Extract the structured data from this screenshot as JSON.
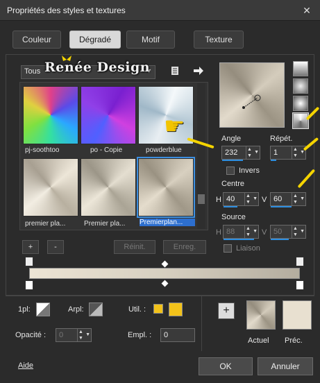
{
  "window": {
    "title": "Propriétés des styles et textures",
    "close_glyph": "✕"
  },
  "tabs": [
    "Couleur",
    "Dégradé",
    "Motif",
    "Texture"
  ],
  "active_tab": "Dégradé",
  "library": {
    "category": "Tous",
    "watermark": "Renée Design",
    "items": [
      {
        "label": "pj-soothtoo",
        "selected": false
      },
      {
        "label": "po - Copie",
        "selected": false
      },
      {
        "label": "powderblue",
        "selected": false
      },
      {
        "label": "premier pla...",
        "selected": false
      },
      {
        "label": "Premier pla...",
        "selected": false
      },
      {
        "label": "Premierplan...",
        "selected": true
      }
    ],
    "add_label": "+",
    "remove_label": "-",
    "reset_label": "Réinit.",
    "save_label": "Enreg."
  },
  "settings": {
    "angle_label": "Angle",
    "angle_value": "232",
    "repeat_label": "Répét.",
    "repeat_value": "1",
    "invert_label": "Invers",
    "center_label": "Centre",
    "center_h_label": "H",
    "center_h": "40",
    "center_v_label": "V",
    "center_v": "60",
    "source_label": "Source",
    "source_h_label": "H",
    "source_h": "88",
    "source_v_label": "V",
    "source_v": "50",
    "link_label": "Liaison"
  },
  "bottom": {
    "pl_label": "1pl:",
    "arpl_label": "Arpl:",
    "util_label": "Util. :",
    "opacity_label": "Opacité :",
    "opacity_value": "0",
    "empl_label": "Empl. :",
    "empl_value": "0",
    "current_label": "Actuel",
    "prev_label": "Préc.",
    "add_glyph": "+"
  },
  "footer": {
    "help_label": "Aide",
    "ok_label": "OK",
    "cancel_label": "Annuler"
  },
  "colors": {
    "accent": "#2d8ee0",
    "highlight_yellow": "#f5d400",
    "util_swatch": "#f2c21a",
    "prev_swatch": "#e8e0d0"
  }
}
